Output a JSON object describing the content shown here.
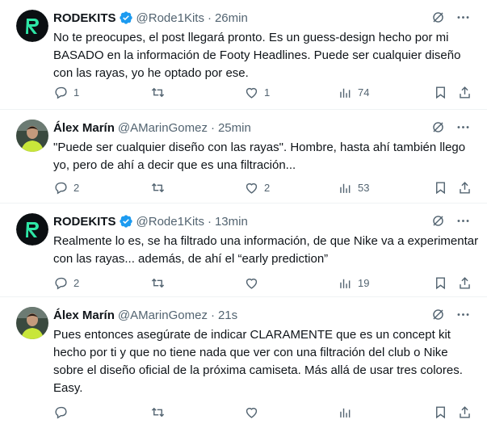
{
  "tweets": [
    {
      "name": "RODEKITS",
      "verified": true,
      "handle": "@Rode1Kits",
      "time": "26min",
      "text": "No te preocupes, el post llegará pronto. Es un guess-design hecho por mi BASADO en la información de Footy Headlines. Puede ser cualquier diseño con las rayas, yo he optado por ese.",
      "replies": "1",
      "retweets": "",
      "likes": "1",
      "views": "74",
      "avatar": "rodekits-logo"
    },
    {
      "name": "Álex Marín",
      "verified": false,
      "handle": "@AMarinGomez",
      "time": "25min",
      "text": "\"Puede ser cualquier diseño con las rayas\". Hombre, hasta ahí también llego yo, pero de ahí a decir que es una filtración...",
      "replies": "2",
      "retweets": "",
      "likes": "2",
      "views": "53",
      "avatar": "user-photo"
    },
    {
      "name": "RODEKITS",
      "verified": true,
      "handle": "@Rode1Kits",
      "time": "13min",
      "text": "Realmente lo es, se ha filtrado una información, de que Nike va a experimentar con las rayas... además, de ahí el “early prediction”",
      "replies": "2",
      "retweets": "",
      "likes": "",
      "views": "19",
      "avatar": "rodekits-logo"
    },
    {
      "name": "Álex Marín",
      "verified": false,
      "handle": "@AMarinGomez",
      "time": "21s",
      "text": "Pues entonces asegúrate de indicar CLARAMENTE que es un concept kit hecho por ti y que no tiene nada que ver con una filtración del club o Nike sobre el diseño oficial de la próxima camiseta. Más allá de usar tres colores. Easy.",
      "replies": "",
      "retweets": "",
      "likes": "",
      "views": "",
      "avatar": "user-photo"
    }
  ],
  "dot_separator": "·",
  "colors": {
    "text": "#0f1419",
    "muted": "#536471",
    "verified": "#1d9bf0",
    "divider": "#eff3f4",
    "logo_bg": "#0b0f12",
    "logo_green": "#2ee6a6"
  }
}
